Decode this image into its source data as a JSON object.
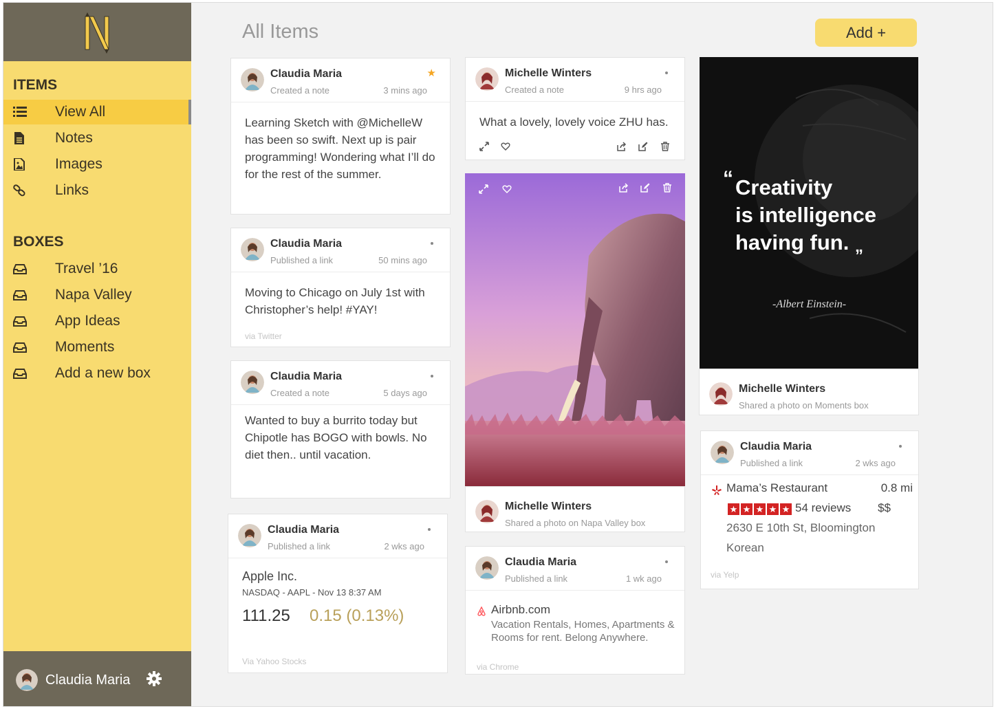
{
  "app": {
    "logo_letter": "N",
    "page_title": "All Items",
    "add_button": "Add +"
  },
  "sidebar": {
    "items_header": "ITEMS",
    "items": [
      {
        "label": "View All",
        "icon": "list-icon",
        "active": true
      },
      {
        "label": "Notes",
        "icon": "document-icon"
      },
      {
        "label": "Images",
        "icon": "image-icon"
      },
      {
        "label": "Links",
        "icon": "link-icon"
      }
    ],
    "boxes_header": "BOXES",
    "boxes": [
      {
        "label": "Travel ’16",
        "icon": "inbox-icon"
      },
      {
        "label": "Napa Valley",
        "icon": "inbox-icon"
      },
      {
        "label": "App Ideas",
        "icon": "inbox-icon"
      },
      {
        "label": "Moments",
        "icon": "inbox-icon"
      },
      {
        "label": "Add a new box",
        "icon": "inbox-icon"
      }
    ],
    "user": {
      "name": "Claudia Maria",
      "settings_icon": "gear-icon"
    }
  },
  "cards": {
    "c1": {
      "name": "Claudia Maria",
      "action": "Created a note",
      "time": "3 mins ago",
      "starred": true,
      "text": "Learning Sketch with @MichelleW has been so swift. Next up is pair programming! Wondering what I’ll do for the rest of the summer."
    },
    "c2": {
      "name": "Claudia Maria",
      "action": "Published a link",
      "time": "50 mins ago",
      "text": "Moving to Chicago on July 1st with Christopher’s help! #YAY!",
      "via": "via Twitter"
    },
    "c3": {
      "name": "Claudia Maria",
      "action": "Created a note",
      "time": "5 days ago",
      "text": "Wanted to buy a burrito today but Chipotle has BOGO with bowls. No diet then.. until vacation."
    },
    "c4": {
      "name": "Claudia Maria",
      "action": "Published a link",
      "time": "2 wks ago",
      "stock_name": "Apple Inc.",
      "stock_sub": "NASDAQ - AAPL - Nov 13 8:37 AM",
      "price": "111.25",
      "change": "0.15 (0.13%)",
      "via": "Via Yahoo Stocks"
    },
    "m1": {
      "name": "Michelle Winters",
      "action": "Created a note",
      "time": "9 hrs ago",
      "text": "What a lovely, lovely voice ZHU has."
    },
    "m2": {
      "name": "Michelle Winters",
      "action": "Shared a photo on Napa Valley box"
    },
    "m3": {
      "name": "Claudia Maria",
      "action": "Published a link",
      "time": "1 wk ago",
      "link_title": "Airbnb.com",
      "link_desc": "Vacation Rentals, Homes, Apartments & Rooms for rent. Belong Anywhere.",
      "via": "via Chrome"
    },
    "r1": {
      "quote_open": "“",
      "quote_line1": "Creativity",
      "quote_line2": "is intelligence",
      "quote_line3": "having fun.",
      "quote_close": "„",
      "author": "-Albert Einstein-",
      "name": "Michelle Winters",
      "action": "Shared a photo on Moments box"
    },
    "r2": {
      "name": "Claudia Maria",
      "action": "Published a link",
      "time": "2 wks ago",
      "place": "Mama’s Restaurant",
      "distance": "0.8 mi",
      "rating": 5,
      "reviews": "54 reviews",
      "price": "$$",
      "address": "2630 E 10th St, Bloomington",
      "category": "Korean",
      "via": "via Yelp"
    }
  },
  "colors": {
    "sidebar_bg": "#f8db70",
    "sidebar_active": "#f7cc44",
    "sidebar_dark": "#6e6858",
    "accent_gold": "#b9a05a",
    "yelp_red": "#d32323"
  }
}
